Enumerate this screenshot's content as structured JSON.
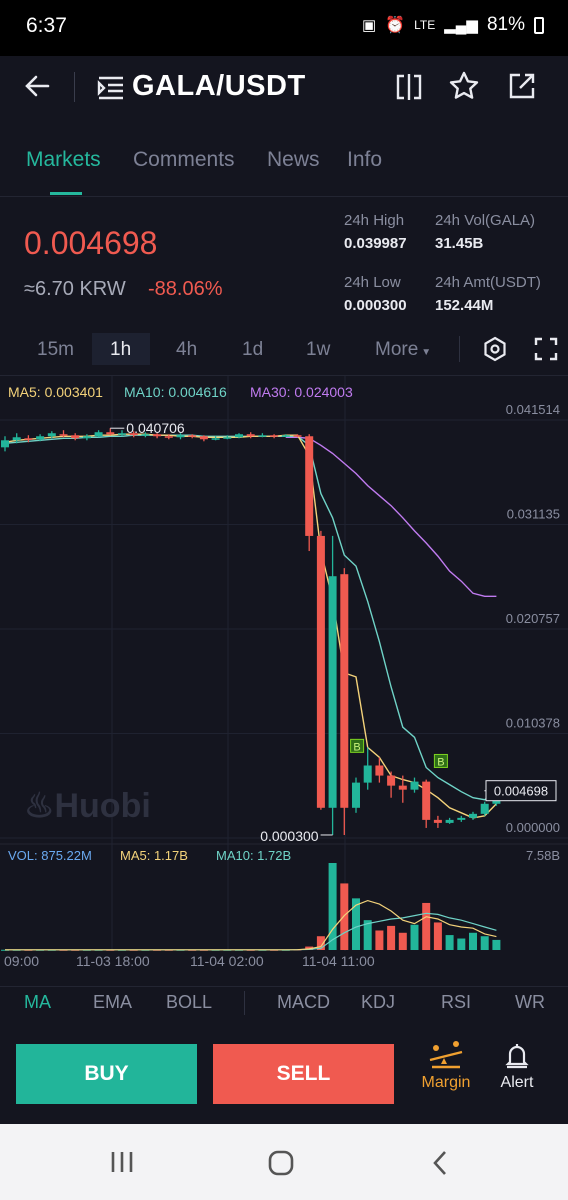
{
  "status_bar": {
    "time": "6:37",
    "network": "LTE",
    "battery": "81%"
  },
  "header": {
    "pair": "GALA/USDT"
  },
  "tabs": [
    {
      "label": "Markets"
    },
    {
      "label": "Comments"
    },
    {
      "label": "News"
    },
    {
      "label": "Info"
    }
  ],
  "ticker": {
    "last_price": "0.004698",
    "approx_krw": "≈6.70 KRW",
    "change": "-88.06%",
    "high_label": "24h High",
    "high": "0.039987",
    "vol_label": "24h Vol(GALA)",
    "vol": "31.45B",
    "low_label": "24h Low",
    "low": "0.000300",
    "amt_label": "24h Amt(USDT)",
    "amt": "152.44M"
  },
  "intervals": [
    {
      "label": "15m"
    },
    {
      "label": "1h"
    },
    {
      "label": "4h"
    },
    {
      "label": "1d"
    },
    {
      "label": "1w"
    },
    {
      "label": "More"
    }
  ],
  "ma_legend": {
    "ma5": "MA5: 0.003401",
    "ma10": "MA10: 0.004616",
    "ma30": "MA30: 0.024003"
  },
  "chart_data": {
    "type": "candlestick",
    "y_axis_ticks": [
      "0.041514",
      "0.031135",
      "0.020757",
      "0.010378",
      "0.000000"
    ],
    "x_axis_ticks": [
      "09:00",
      "11-03 18:00",
      "11-04 02:00",
      "11-04 11:00"
    ],
    "annotations": {
      "high_marker": "0.040706",
      "low_marker": "0.000300",
      "last_price_tag": "0.004698",
      "buy_markers": [
        "B",
        "B"
      ]
    },
    "ylim": [
      0,
      0.045
    ],
    "ma_colors": {
      "ma5": "#f3d27a",
      "ma10": "#6fd3c7",
      "ma30": "#c07bf0"
    },
    "candle_colors": {
      "up": "#22b59a",
      "down": "#f05a50"
    },
    "candles": [
      [
        0.0388,
        0.0395,
        0.0399,
        0.0384
      ],
      [
        0.0395,
        0.0398,
        0.0402,
        0.0392
      ],
      [
        0.0397,
        0.0396,
        0.04,
        0.0393
      ],
      [
        0.0396,
        0.0399,
        0.0401,
        0.0394
      ],
      [
        0.0399,
        0.0402,
        0.0404,
        0.0397
      ],
      [
        0.0401,
        0.04,
        0.0405,
        0.0398
      ],
      [
        0.04,
        0.0397,
        0.0402,
        0.0395
      ],
      [
        0.0397,
        0.0399,
        0.0401,
        0.0395
      ],
      [
        0.0399,
        0.0403,
        0.0405,
        0.0398
      ],
      [
        0.0403,
        0.0401,
        0.0407,
        0.04
      ],
      [
        0.0401,
        0.0402,
        0.0405,
        0.0399
      ],
      [
        0.0402,
        0.04,
        0.0404,
        0.0398
      ],
      [
        0.04,
        0.0401,
        0.0403,
        0.0398
      ],
      [
        0.0401,
        0.0399,
        0.0402,
        0.0397
      ],
      [
        0.0399,
        0.0398,
        0.0401,
        0.0396
      ],
      [
        0.0398,
        0.04,
        0.0402,
        0.0396
      ],
      [
        0.04,
        0.0399,
        0.0401,
        0.0397
      ],
      [
        0.0399,
        0.0396,
        0.04,
        0.0394
      ],
      [
        0.0396,
        0.0397,
        0.0399,
        0.0395
      ],
      [
        0.0397,
        0.0398,
        0.04,
        0.0396
      ],
      [
        0.0398,
        0.0401,
        0.0402,
        0.0397
      ],
      [
        0.0401,
        0.0399,
        0.0403,
        0.0397
      ],
      [
        0.0399,
        0.04,
        0.0402,
        0.0398
      ],
      [
        0.04,
        0.0399,
        0.0401,
        0.0397
      ],
      [
        0.0399,
        0.04,
        0.0401,
        0.0398
      ],
      [
        0.04,
        0.0399,
        0.0401,
        0.0398
      ],
      [
        0.0399,
        0.03,
        0.0401,
        0.0285
      ],
      [
        0.03,
        0.003,
        0.0305,
        0.0028
      ],
      [
        0.003,
        0.026,
        0.03,
        0.0003
      ],
      [
        0.0262,
        0.003,
        0.0268,
        0.0003
      ],
      [
        0.003,
        0.0055,
        0.006,
        0.0025
      ],
      [
        0.0055,
        0.0072,
        0.009,
        0.0048
      ],
      [
        0.0072,
        0.0062,
        0.008,
        0.0055
      ],
      [
        0.0062,
        0.0052,
        0.0066,
        0.004
      ],
      [
        0.0052,
        0.0048,
        0.0062,
        0.0035
      ],
      [
        0.0048,
        0.0056,
        0.006,
        0.0045
      ],
      [
        0.0056,
        0.0018,
        0.0058,
        0.001
      ],
      [
        0.0018,
        0.0015,
        0.0022,
        0.001
      ],
      [
        0.0015,
        0.0018,
        0.002,
        0.0014
      ],
      [
        0.0018,
        0.002,
        0.0022,
        0.0016
      ],
      [
        0.002,
        0.0024,
        0.0026,
        0.0018
      ],
      [
        0.0024,
        0.0034,
        0.0036,
        0.0022
      ],
      [
        0.0034,
        0.0047,
        0.0052,
        0.0032
      ]
    ],
    "ma5": [
      0.0393,
      0.0395,
      0.0396,
      0.0397,
      0.0398,
      0.0399,
      0.0399,
      0.0399,
      0.04,
      0.04,
      0.0401,
      0.0401,
      0.0401,
      0.04,
      0.04,
      0.0399,
      0.0399,
      0.0398,
      0.0398,
      0.0398,
      0.0398,
      0.0399,
      0.0399,
      0.0399,
      0.04,
      0.04,
      0.038,
      0.0285,
      0.0237,
      0.0164,
      0.016,
      0.009,
      0.008,
      0.0062,
      0.0058,
      0.0055,
      0.0048,
      0.004,
      0.003,
      0.0025,
      0.002,
      0.0022,
      0.0034
    ],
    "ma10": [
      0.0392,
      0.0393,
      0.0394,
      0.0395,
      0.0396,
      0.0397,
      0.0397,
      0.0398,
      0.0398,
      0.0399,
      0.0399,
      0.04,
      0.04,
      0.04,
      0.04,
      0.04,
      0.04,
      0.0399,
      0.0399,
      0.0399,
      0.0399,
      0.0399,
      0.0399,
      0.0399,
      0.0399,
      0.0399,
      0.039,
      0.0342,
      0.0318,
      0.0281,
      0.027,
      0.0235,
      0.0195,
      0.015,
      0.011,
      0.01,
      0.007,
      0.006,
      0.0053,
      0.0046,
      0.004,
      0.0038,
      0.0046
    ],
    "ma30": [
      null,
      null,
      null,
      null,
      null,
      null,
      null,
      null,
      null,
      null,
      null,
      null,
      null,
      null,
      null,
      null,
      null,
      null,
      null,
      null,
      null,
      null,
      null,
      null,
      0.0398,
      0.0398,
      0.0397,
      0.039,
      0.0382,
      0.0372,
      0.0362,
      0.035,
      0.034,
      0.033,
      0.0318,
      0.0305,
      0.0293,
      0.028,
      0.0265,
      0.0255,
      0.0243,
      0.024,
      0.024
    ],
    "volume": {
      "legend": {
        "vol": "VOL: 875.22M",
        "ma5": "MA5: 1.17B",
        "ma10": "MA10: 1.72B"
      },
      "max_label": "7.58B",
      "values": [
        0.02,
        0.02,
        0.02,
        0.02,
        0.02,
        0.02,
        0.02,
        0.02,
        0.02,
        0.02,
        0.02,
        0.02,
        0.02,
        0.02,
        0.02,
        0.02,
        0.02,
        0.02,
        0.02,
        0.02,
        0.02,
        0.02,
        0.02,
        0.02,
        0.02,
        0.05,
        0.3,
        1.2,
        7.58,
        5.8,
        4.5,
        2.6,
        1.7,
        2.1,
        1.5,
        2.2,
        4.1,
        2.4,
        1.3,
        1.0,
        1.5,
        1.2,
        0.88
      ],
      "ma5": [
        0.02,
        0.02,
        0.02,
        0.02,
        0.02,
        0.02,
        0.02,
        0.02,
        0.02,
        0.02,
        0.02,
        0.02,
        0.02,
        0.02,
        0.02,
        0.02,
        0.02,
        0.02,
        0.02,
        0.02,
        0.02,
        0.02,
        0.02,
        0.02,
        0.02,
        0.03,
        0.1,
        0.3,
        1.8,
        3.0,
        3.9,
        4.3,
        4.0,
        3.4,
        2.6,
        2.3,
        2.9,
        2.7,
        2.2,
        2.0,
        1.9,
        1.4,
        1.17
      ],
      "ma10": [
        0.02,
        0.02,
        0.02,
        0.02,
        0.02,
        0.02,
        0.02,
        0.02,
        0.02,
        0.02,
        0.02,
        0.02,
        0.02,
        0.02,
        0.02,
        0.02,
        0.02,
        0.02,
        0.02,
        0.02,
        0.02,
        0.02,
        0.02,
        0.02,
        0.02,
        0.03,
        0.05,
        0.15,
        0.9,
        1.5,
        2.0,
        2.3,
        2.5,
        2.7,
        2.8,
        3.0,
        3.2,
        3.1,
        2.8,
        2.6,
        2.3,
        2.0,
        1.72
      ]
    }
  },
  "watermark": "Huobi",
  "indicators": [
    {
      "label": "MA"
    },
    {
      "label": "EMA"
    },
    {
      "label": "BOLL"
    },
    {
      "label": "MACD"
    },
    {
      "label": "KDJ"
    },
    {
      "label": "RSI"
    },
    {
      "label": "WR"
    }
  ],
  "actions": {
    "buy": "BUY",
    "sell": "SELL",
    "margin": "Margin",
    "alert": "Alert"
  }
}
